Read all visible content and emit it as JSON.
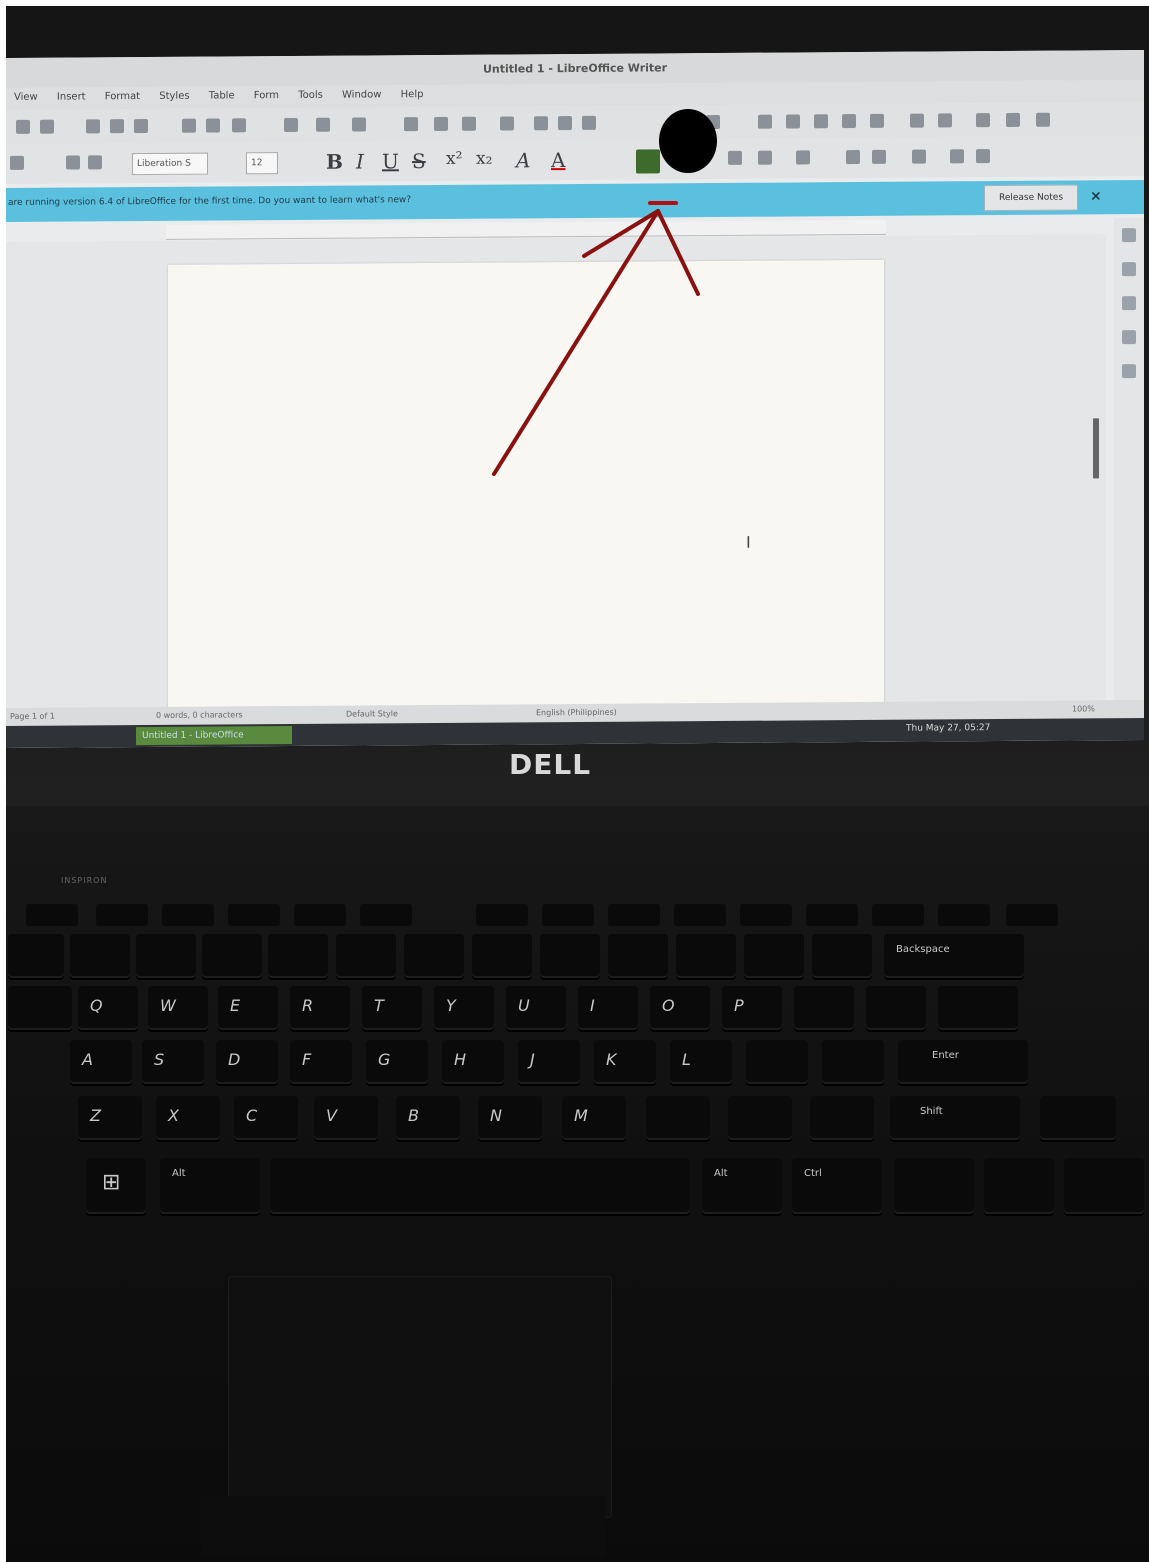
{
  "window": {
    "title": "Untitled 1 - LibreOffice Writer"
  },
  "menu": [
    "View",
    "Insert",
    "Format",
    "Styles",
    "Table",
    "Form",
    "Tools",
    "Window",
    "Help"
  ],
  "formatting": {
    "font_name": "Liberation S",
    "font_size": "12",
    "bold": "B",
    "italic": "I",
    "underline": "U",
    "strike": "S",
    "superscript": "x²",
    "subscript": "x₂",
    "shadow": "A",
    "font_color": "A"
  },
  "infobar": {
    "message": "are running version 6.4 of LibreOffice for the first time. Do you want to learn what's new?",
    "button": "Release Notes",
    "close": "×"
  },
  "document": {
    "cursor": "I"
  },
  "statusbar": {
    "page": "Page 1 of 1",
    "words": "0 words, 0 characters",
    "style": "Default Style",
    "language": "English (Philippines)",
    "zoom": "100%"
  },
  "taskbar": {
    "app": "Untitled 1 - LibreOffice",
    "clock": "Thu May 27, 05:27"
  },
  "laptop": {
    "logo": "DELL",
    "model": "INSPIRON"
  },
  "keyboard": {
    "row1": [
      "Q",
      "W",
      "E",
      "R",
      "T",
      "Y",
      "U",
      "I",
      "O",
      "P"
    ],
    "row2": [
      "A",
      "S",
      "D",
      "F",
      "G",
      "H",
      "J",
      "K",
      "L"
    ],
    "row3": [
      "Z",
      "X",
      "C",
      "V",
      "B",
      "N",
      "M"
    ],
    "enter": "Enter",
    "shift": "Shift",
    "backspace": "Backspace",
    "alt": "Alt",
    "ctrl": "Ctrl"
  },
  "colors": {
    "infobar": "#5bc0de",
    "annotation_arrow": "#8b1010",
    "highlight_swatch": "#3e6b2b"
  }
}
